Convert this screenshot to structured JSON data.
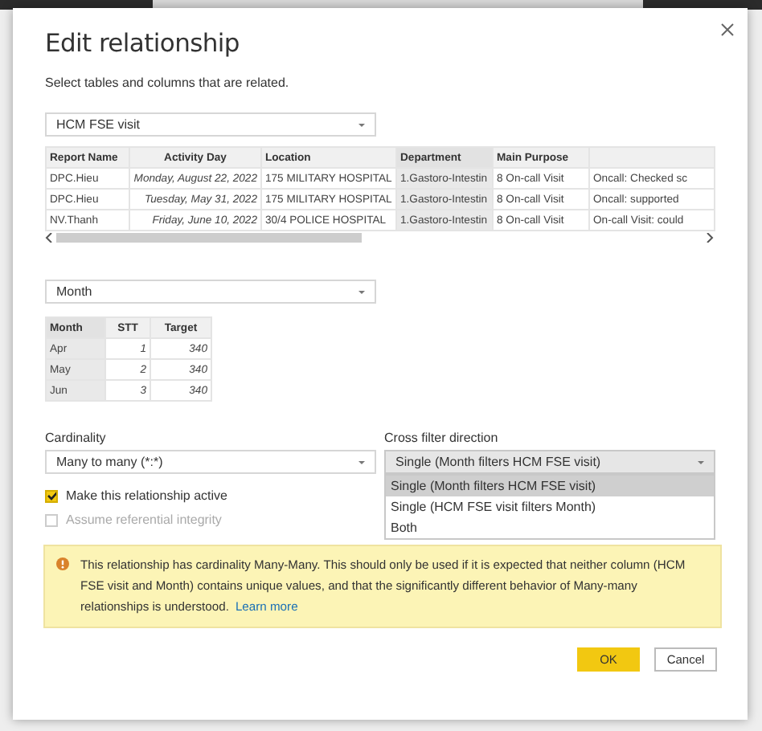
{
  "dialog": {
    "title": "Edit relationship",
    "subtitle": "Select tables and columns that are related.",
    "tables": [
      {
        "dropdown": {
          "value": "HCM FSE visit"
        },
        "scrollbar": true,
        "columns": [
          {
            "label": "Report Name",
            "kind": "text",
            "selected": false
          },
          {
            "label": "Activity Day",
            "kind": "date",
            "selected": false
          },
          {
            "label": "Location",
            "kind": "text",
            "selected": false
          },
          {
            "label": "Department",
            "kind": "text",
            "selected": true
          },
          {
            "label": "Main Purpose",
            "kind": "text",
            "selected": false
          },
          {
            "kind": "text",
            "selected": false
          }
        ],
        "rows": [
          [
            "DPC.Hieu",
            "Monday, August 22, 2022",
            "175 MILITARY HOSPITAL",
            "1.Gastoro-Intestin",
            "8 On-call Visit",
            "Oncall: Checked sc"
          ],
          [
            "DPC.Hieu",
            "Tuesday, May 31, 2022",
            "175 MILITARY HOSPITAL",
            "1.Gastoro-Intestin",
            "8 On-call Visit",
            "Oncall: supported"
          ],
          [
            "NV.Thanh",
            "Friday, June 10, 2022",
            "30/4 POLICE HOSPITAL",
            "1.Gastoro-Intestin",
            "8 On-call Visit",
            "On-call Visit: could"
          ]
        ]
      },
      {
        "dropdown": {
          "value": "Month"
        },
        "scrollbar": false,
        "columns": [
          {
            "label": "Month",
            "kind": "text",
            "selected": true
          },
          {
            "label": "STT",
            "kind": "number",
            "selected": false
          },
          {
            "label": "Target",
            "kind": "number",
            "selected": false
          }
        ],
        "rows": [
          [
            "Apr",
            "1",
            "340"
          ],
          [
            "May",
            "2",
            "340"
          ],
          [
            "Jun",
            "3",
            "340"
          ]
        ]
      }
    ],
    "cardinality": {
      "label": "Cardinality",
      "value": "Many to many (*:*)"
    },
    "cross_filter": {
      "label": "Cross filter direction",
      "value": "Single (Month filters HCM FSE visit)",
      "expanded": true,
      "options": [
        {
          "label": "Single (Month filters HCM FSE visit)",
          "selected": true
        },
        {
          "label": "Single (HCM FSE visit filters Month)",
          "selected": false
        },
        {
          "label": "Both",
          "selected": false
        }
      ]
    },
    "checkboxes": [
      {
        "label": "Make this relationship active",
        "checked": true,
        "disabled": false
      },
      {
        "label": "Assume referential integrity",
        "checked": false,
        "disabled": true
      }
    ],
    "warning": {
      "text": "This relationship has cardinality Many-Many. This should only be used if it is expected that neither column (HCM FSE visit and Month) contains unique values, and that the significantly different behavior of Many-many relationships is understood.",
      "link": "Learn more"
    },
    "buttons": [
      {
        "label": "OK",
        "kind": "primary"
      },
      {
        "label": "Cancel",
        "kind": "secondary"
      }
    ]
  }
}
